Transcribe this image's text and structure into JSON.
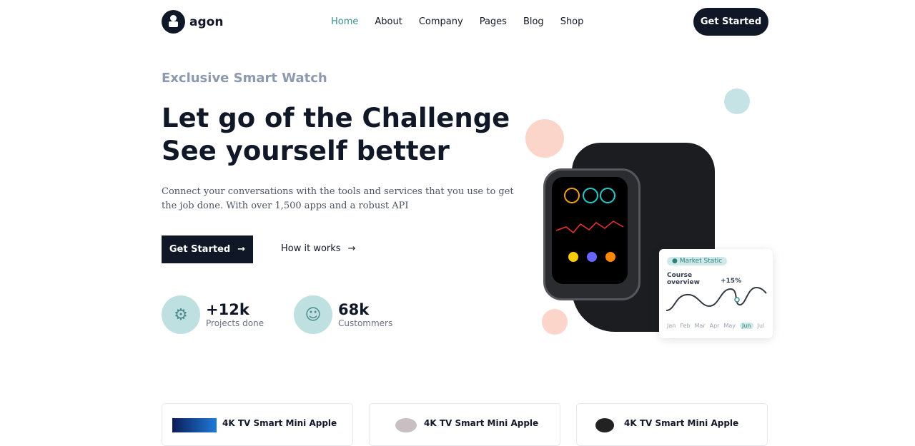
{
  "brand": {
    "name": "agon"
  },
  "nav": {
    "items": [
      "Home",
      "About",
      "Company",
      "Pages",
      "Blog",
      "Shop"
    ],
    "active": "Home",
    "cta": "Get Started"
  },
  "hero": {
    "eyebrow": "Exclusive Smart Watch",
    "title_line1": "Let go of the Challenge",
    "title_line2": "See yourself better",
    "description": "Connect your conversations with the tools and services that you use to get the job done. With over 1,500 apps and a robust API",
    "primary_button": "Get Started",
    "secondary_button": "How it works"
  },
  "stats": [
    {
      "value": "+12k",
      "label": "Projects done",
      "icon": "projects-icon"
    },
    {
      "value": "68k",
      "label": "Custommers",
      "icon": "customers-icon"
    }
  ],
  "market_card": {
    "badge": "Market Static",
    "title": "Course overview",
    "change": "+15%",
    "months": [
      "Jan",
      "Feb",
      "Mar",
      "Apr",
      "May",
      "Jun",
      "Jul"
    ],
    "selected_month": "Jun"
  },
  "products": [
    {
      "title": "4K TV Smart Mini Apple"
    },
    {
      "title": "4K TV Smart Mini Apple"
    },
    {
      "title": "4K TV Smart Mini Apple"
    }
  ],
  "colors": {
    "dark": "#101828",
    "accent": "#3f8d8f",
    "teal_light": "#bfe0e1",
    "peach": "#fcd5ca"
  }
}
